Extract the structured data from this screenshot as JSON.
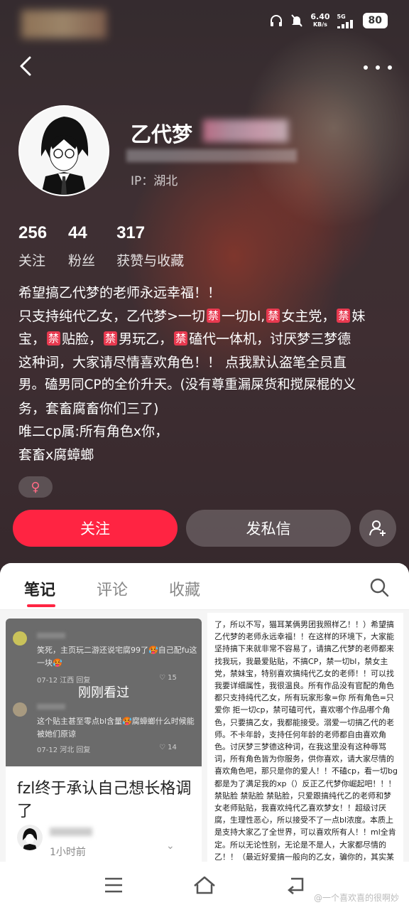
{
  "status": {
    "speed": "6.40",
    "speed_unit": "KB/s",
    "network": "5G",
    "battery": "80"
  },
  "profile": {
    "name": "乙代梦",
    "ip": "IP：湖北",
    "stats": [
      {
        "num": "256",
        "label": "关注"
      },
      {
        "num": "44",
        "label": "粉丝"
      },
      {
        "num": "317",
        "label": "获赞与收藏"
      }
    ],
    "bio": {
      "l1": "希望搞乙代梦的老师永远幸福！！",
      "l2a": "只支持纯代乙女，乙代梦>一切",
      "ban": "禁",
      "l2b": "一切bl,",
      "l2c": "女主党，",
      "l2d": "妹",
      "l3a": "宝，",
      "l3b": "贴脸，",
      "l3c": "男玩乙，",
      "l3d": "磕代一体机，讨厌梦三梦德",
      "l4": "这种词，大家请尽情喜欢角色！！ 点我默认盗笔全员直",
      "l5": "男。磕男同CP的全价升天。(没有尊重漏屎货和搅屎棍的义",
      "l6": "务，套畜腐畜你们三了)",
      "l7": "唯二cp属:所有角色x你，",
      "l8": "套畜x腐蟑螂"
    },
    "gender_symbol": "♀",
    "follow_label": "关注",
    "message_label": "发私信"
  },
  "tabs": [
    "笔记",
    "评论",
    "收藏"
  ],
  "card1": {
    "comment1": "笑死，主页玩二游还说宅腐99了🥵自己配fu这一块🥵",
    "meta1": "07-12 江西   回复",
    "likes1": "15",
    "seen_label": "刚刚看过",
    "comment2": "这个贴主甚至零点bl含量🥵腐蟑螂什么时候能被她们原谅",
    "meta2": "07-12 河北   回复",
    "likes2": "14",
    "title": "fzl终于承认自己想长格调了",
    "time": "1小时前"
  },
  "card2": {
    "text": "了，所以不写，猫耳某俩男团我照样乙！！）希望搞乙代梦的老师永远幸福！！在这样的环境下，大家能坚持搞下来就非常不容易了，请搞乙代梦的老师都来找我玩，我最爱贴贴，不搞CP，禁一切bl，禁女主党，禁妹宝，特别喜欢搞纯代乙女的老师！！可以找我要详细属性，我很温良。所有作品没有官配的角色都只支持纯代乙女，所有玩家形象=你  所有角色=只爱你  拒一切cp，禁可磕可代，喜欢哪个作品哪个角色，只要搞乙女，我都能接受。溺爱一切搞乙代的老师。不卡年龄，支持任何年龄的老师都自由喜欢角色。讨厌梦三梦德这种词，在我这里没有这种辱骂词，所有角色皆为你服务，供你喜欢，请大家尽情的喜欢角色吧，那只是你的爱人！！不磕cp，看一切bg都是为了满足我的xp（）反正乙代梦你崛起吧！！！禁贴脸 禁贴脸 禁贴脸，只爱跟搞纯代乙的老师和梦女老师贴贴，我喜欢纯代乙喜欢梦女！！超级讨厌腐，生理性恶心，所以接受不了一点bl浓度。本质上是支持大家乙了全世界，可以喜欢所有人！！ml全肯定。所以无论性别，无论是不是人，大家都尽情的乙！！（最近好爱搞一般向的乙女，骗你的，其实某他"
  },
  "watermark": "一个喜欢喜的很啊妙"
}
